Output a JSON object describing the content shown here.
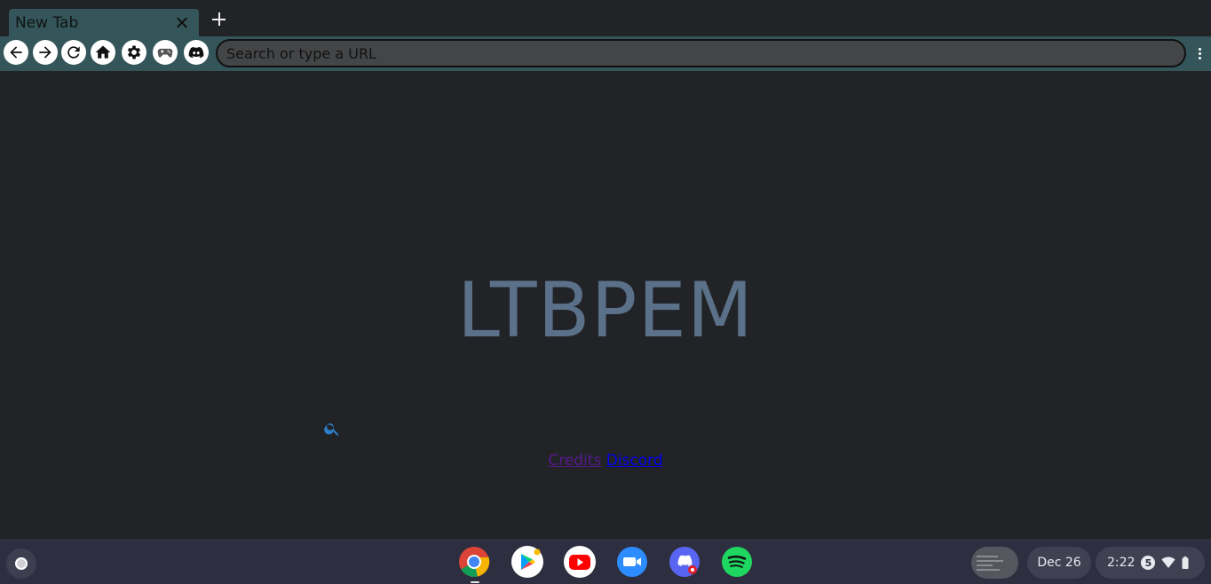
{
  "browser": {
    "tab": {
      "title": "New Tab"
    },
    "omnibox": {
      "placeholder": "Search or type a URL",
      "value": ""
    },
    "toolbar_icons": [
      "back-icon",
      "forward-icon",
      "reload-icon",
      "home-icon",
      "settings-icon",
      "gamepad-icon",
      "discord-icon"
    ]
  },
  "page": {
    "logo": "LTBPEM",
    "links": {
      "credits": "Credits",
      "discord": "Discord"
    }
  },
  "shelf": {
    "apps": [
      "Chrome",
      "Play Store",
      "YouTube",
      "Zoom",
      "Discord",
      "Spotify"
    ],
    "date": "Dec 26",
    "time": "2:22",
    "notification_count": "5"
  },
  "colors": {
    "accent": "#34565a",
    "logo": "#5a7189",
    "background": "#222327",
    "shelf": "#2d2e40"
  }
}
